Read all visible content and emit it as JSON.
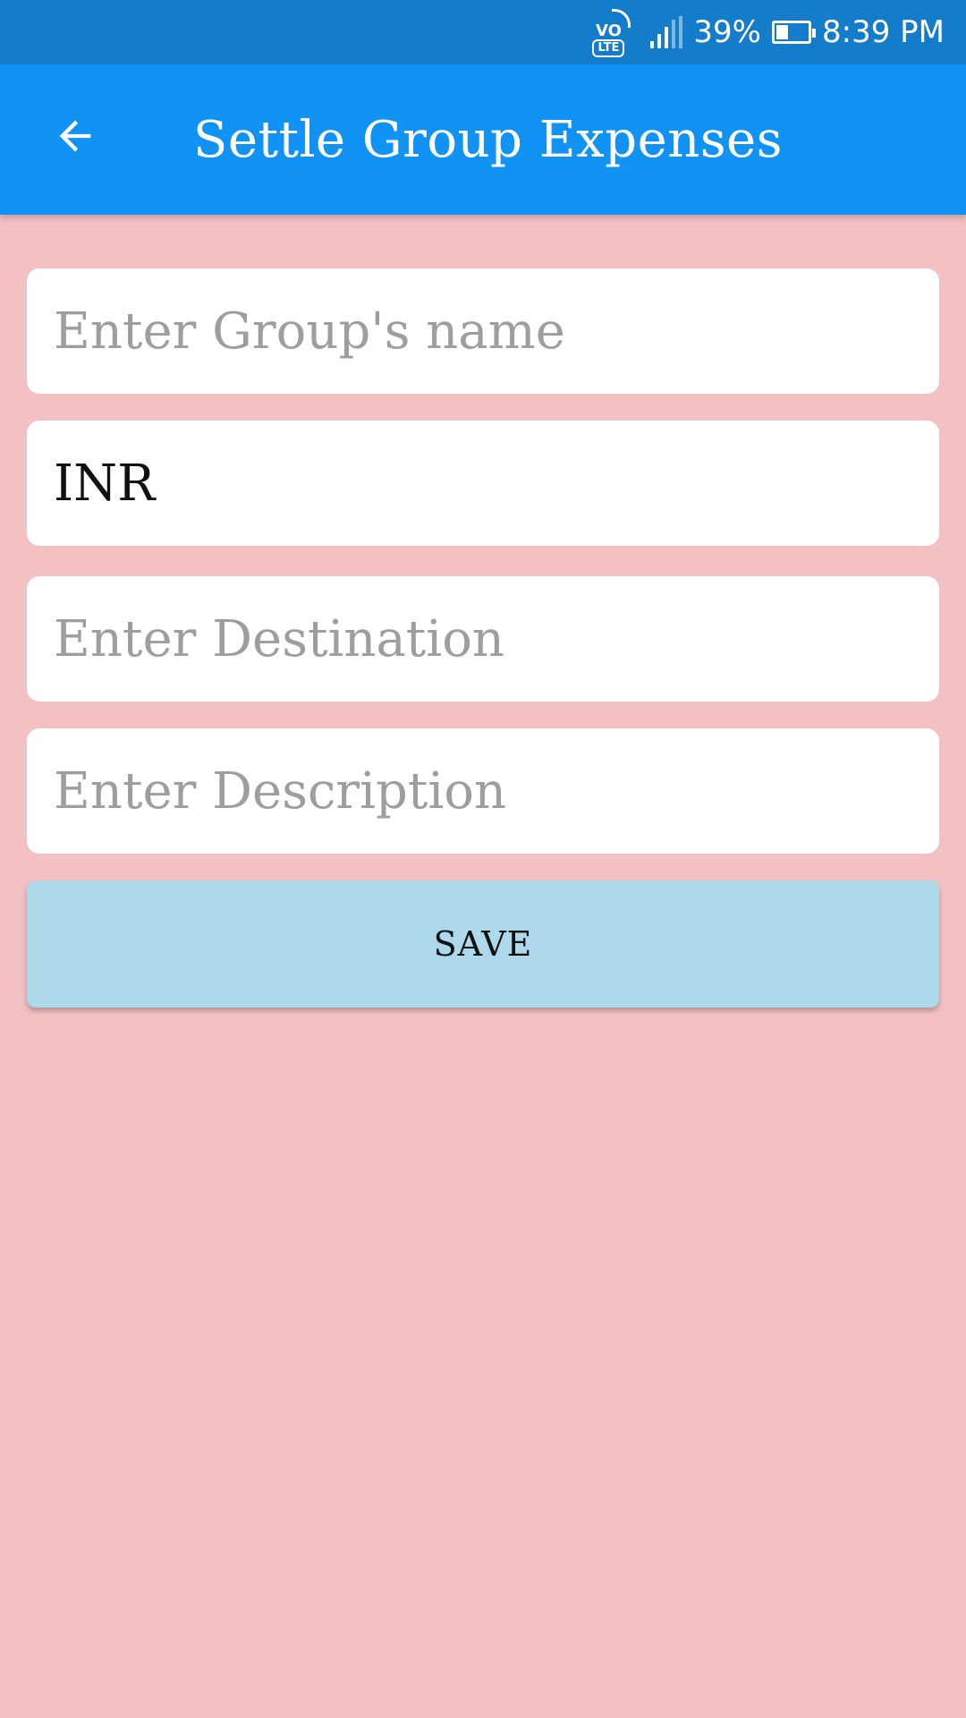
{
  "status_bar": {
    "volte_vo": "VO",
    "volte_lte": "LTE",
    "battery_percent": "39%",
    "battery_level": 0.39,
    "time": "8:39 PM",
    "icons": [
      "volte-icon",
      "signal-icon",
      "battery-icon"
    ]
  },
  "app_bar": {
    "title": "Settle Group Expenses",
    "back_icon": "arrow-left-icon",
    "background": "#1193f5"
  },
  "form": {
    "group_name": {
      "value": "",
      "placeholder": "Enter Group's name"
    },
    "currency": {
      "value": "INR",
      "placeholder": ""
    },
    "destination": {
      "value": "",
      "placeholder": "Enter Destination"
    },
    "description": {
      "value": "",
      "placeholder": "Enter Description"
    },
    "save_label": "SAVE"
  },
  "colors": {
    "page_background": "#f4c1c3",
    "status_bar": "#137ccb",
    "save_button": "#add9ea"
  }
}
